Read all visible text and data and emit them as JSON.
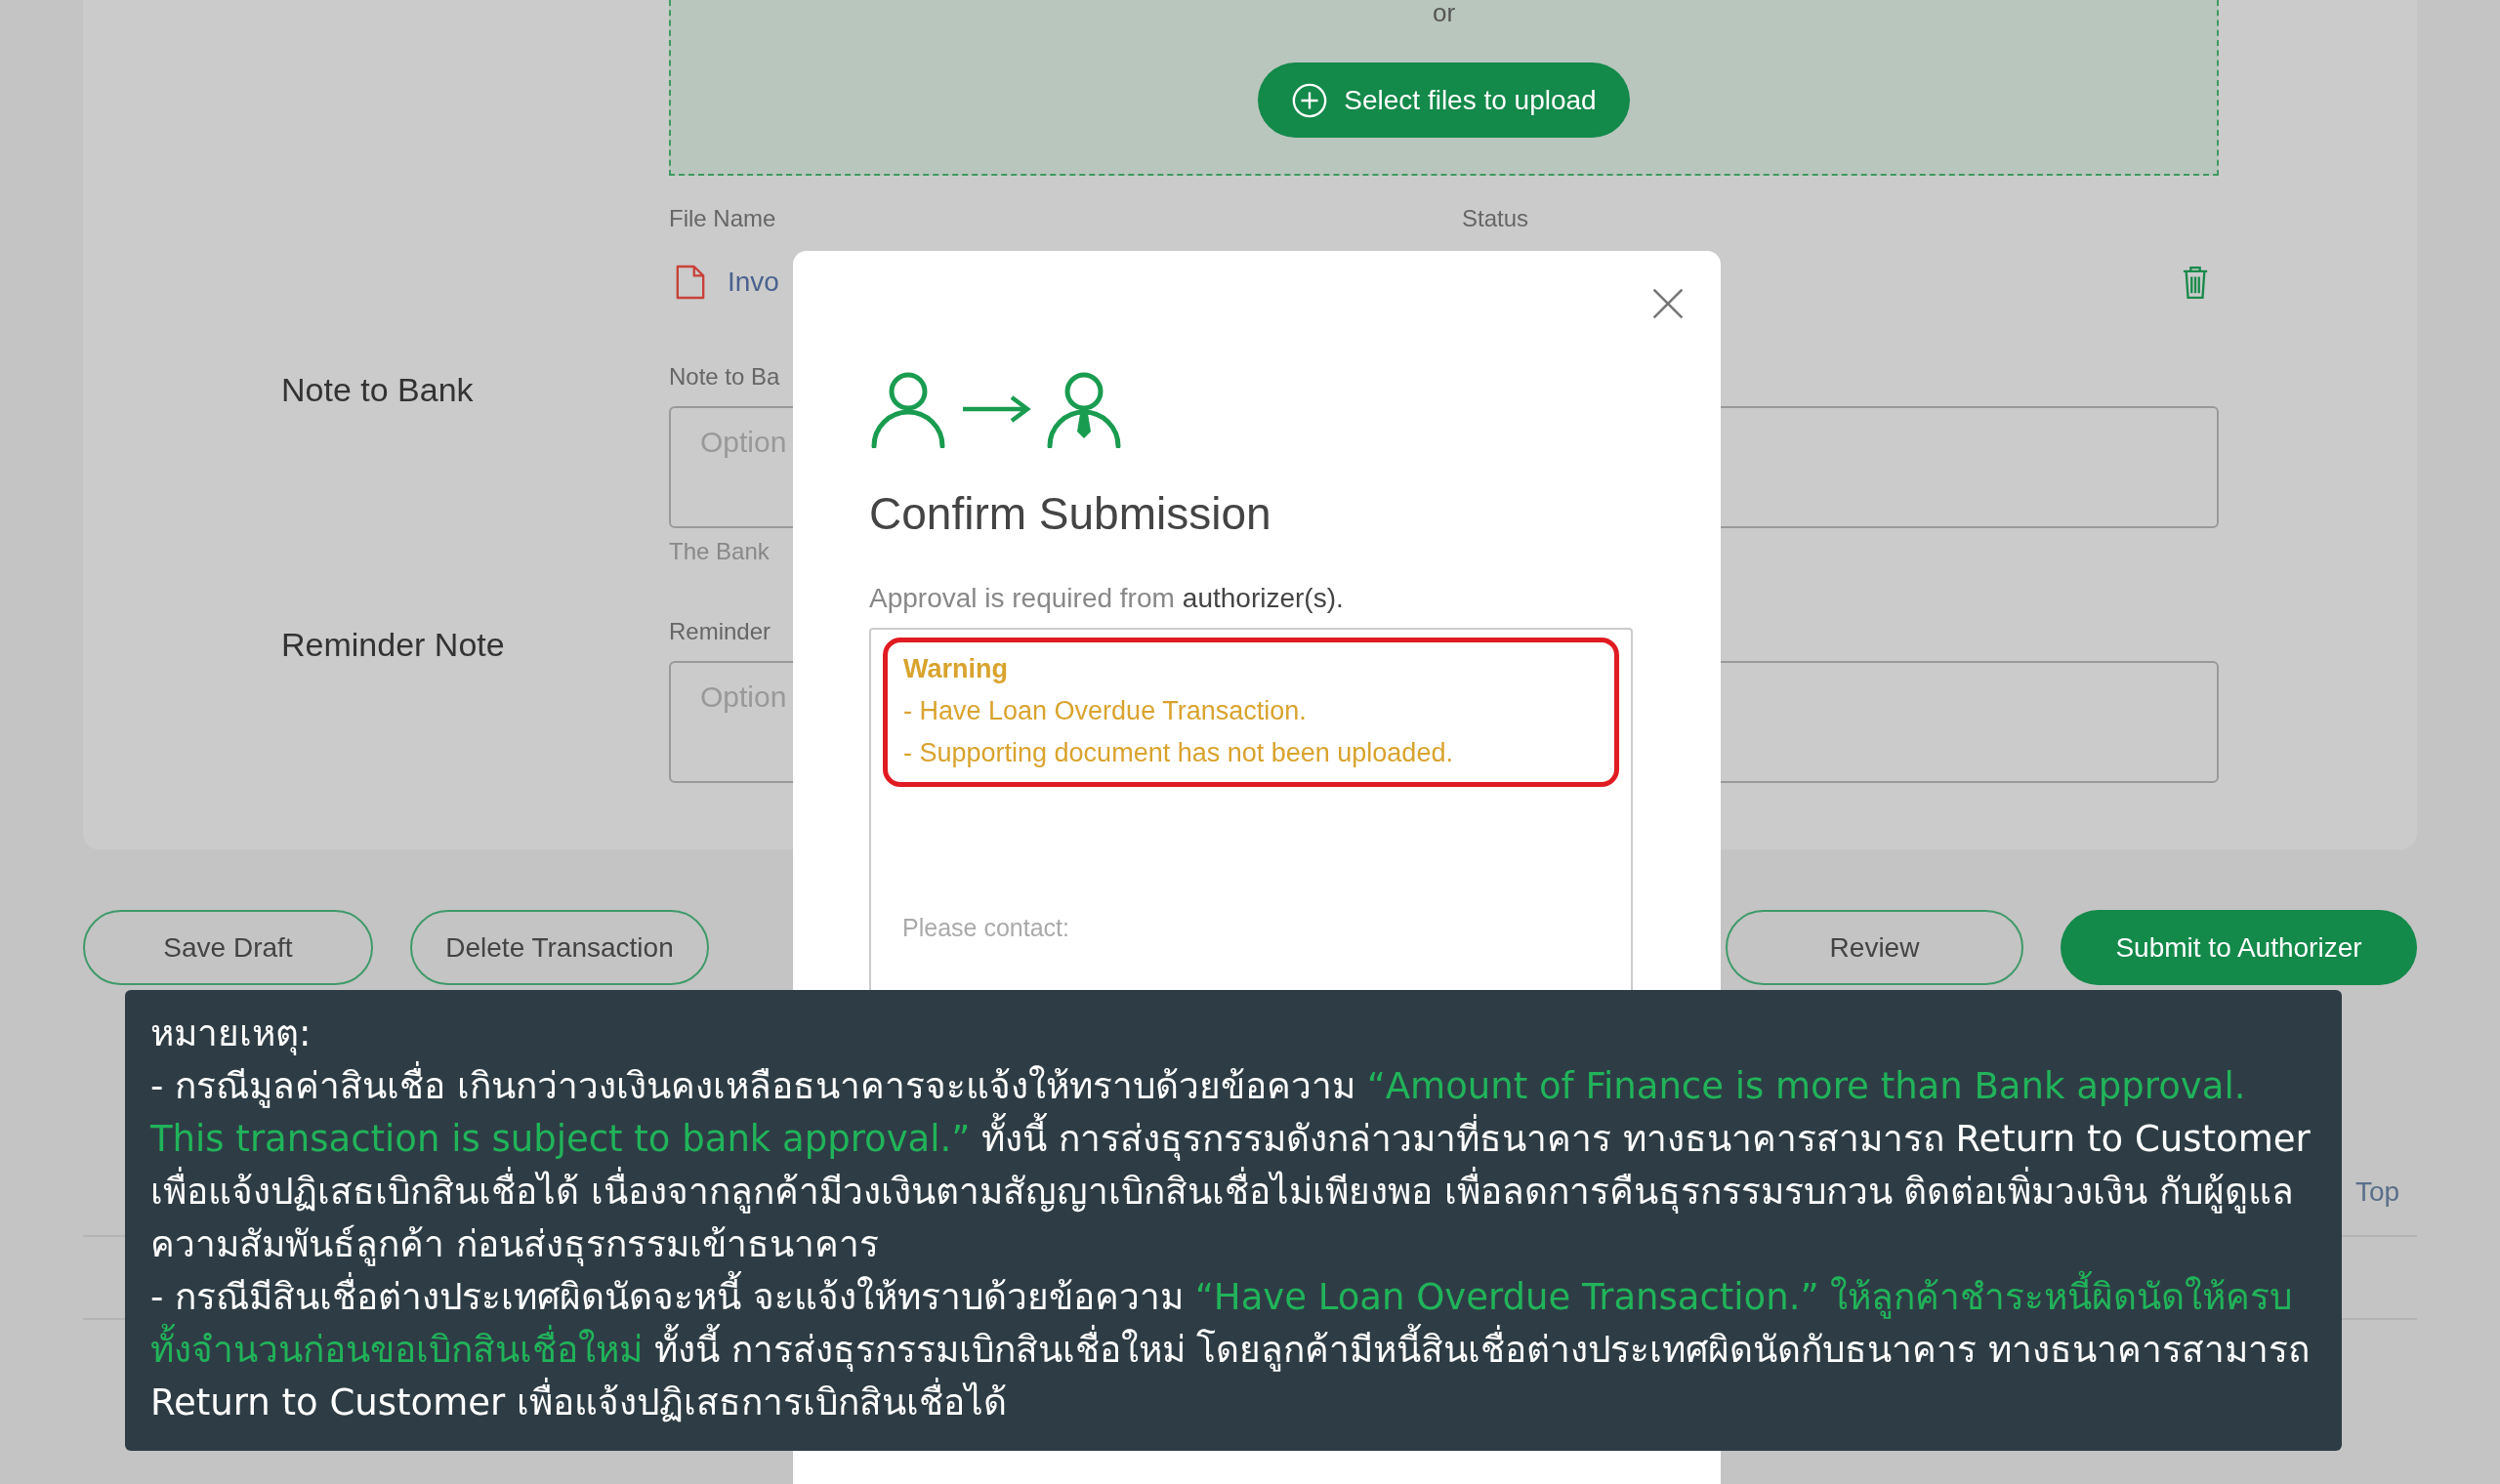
{
  "upload": {
    "or_text": "or",
    "button": "Select files to upload"
  },
  "files": {
    "columns": [
      "File Name",
      "Status"
    ],
    "rows": [
      {
        "name": "Invo"
      }
    ]
  },
  "fields": [
    {
      "label": "Note to Bank",
      "field_label": "Note to Ba",
      "placeholder": "Option",
      "helper": "The Bank"
    },
    {
      "label": "Reminder Note",
      "field_label": "Reminder",
      "placeholder": "Option"
    }
  ],
  "actions": [
    {
      "label": "Save Draft",
      "kind": "outline"
    },
    {
      "label": "Delete Transaction",
      "kind": "outline"
    },
    {
      "label": "Review",
      "kind": "outline"
    },
    {
      "label": "Submit to Authorizer",
      "kind": "primary"
    }
  ],
  "back_to_top": "Top",
  "modal": {
    "title": "Confirm Submission",
    "intro": "Approval is required from",
    "intro_emphasis": "authorizer(s).",
    "warning": {
      "title": "Warning",
      "lines": [
        "- Have Loan Overdue Transaction.",
        "- Supporting document has not been uploaded."
      ]
    },
    "contact": "Please contact:"
  },
  "note": {
    "title": "หมายเหตุ:",
    "items": [
      [
        {
          "text": "- กรณีมูลค่าสินเชื่อ เกินกว่าวงเงินคงเหลือธนาคารจะแจ้งให้ทราบด้วยข้อความ ",
          "highlight": false
        },
        {
          "text": "“Amount of Finance is more than Bank approval. This transaction is subject to bank approval.”",
          "highlight": true
        },
        {
          "text": " ทั้งนี้  การส่งธุรกรรมดังกล่าวมาที่ธนาคาร ทางธนาคารสามารถ Return to Customer เพื่อแจ้งปฏิเสธเบิกสินเชื่อได้ เนื่องจากลูกค้ามีวงเงินตามสัญญาเบิกสินเชื่อไม่เพียงพอ เพื่อลดการคืนธุรกรรมรบกวน ติดต่อเพิ่มวงเงิน กับผู้ดูแลความสัมพันธ์ลูกค้า ก่อนส่งธุรกรรมเข้าธนาคาร",
          "highlight": false
        }
      ],
      [
        {
          "text": "- กรณีมีสินเชื่อต่างประเทศผิดนัดจะหนี้ จะแจ้งให้ทราบด้วยข้อความ ",
          "highlight": false
        },
        {
          "text": "“Have Loan Overdue Transaction.” ให้ลูกค้าชำระหนี้ผิดนัดให้ครบทั้งจำนวนก่อนขอเบิกสินเชื่อใหม่",
          "highlight": true
        },
        {
          "text": " ทั้งนี้ การส่งธุรกรรมเบิกสินเชื่อใหม่ โดยลูกค้ามีหนี้สินเชื่อต่างประเทศผิดนัดกับธนาคาร ทางธนาคารสามารถ Return to Customer เพื่อแจ้งปฏิเสธการเบิกสินเชื่อได้",
          "highlight": false
        }
      ]
    ]
  }
}
